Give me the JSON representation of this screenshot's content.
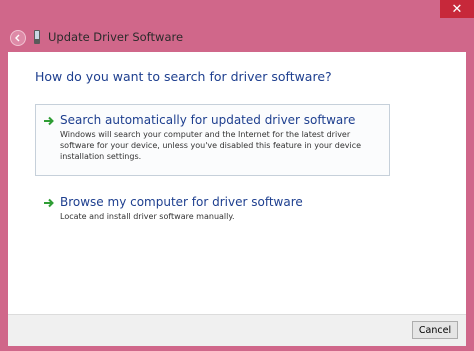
{
  "window": {
    "title": "Update Driver Software",
    "close_glyph": "✕"
  },
  "main": {
    "heading": "How do you want to search for driver software?",
    "options": [
      {
        "title": "Search automatically for updated driver software",
        "description": "Windows will search your computer and the Internet for the latest driver software for your device, unless you've disabled this feature in your device installation settings.",
        "icon": "green-arrow-icon"
      },
      {
        "title": "Browse my computer for driver software",
        "description": "Locate and install driver software manually.",
        "icon": "green-arrow-icon"
      }
    ]
  },
  "footer": {
    "cancel_label": "Cancel"
  },
  "colors": {
    "frame": "#d0678a",
    "close": "#c7283a",
    "link_blue": "#1e3f8f",
    "arrow_green": "#2e9d34"
  }
}
